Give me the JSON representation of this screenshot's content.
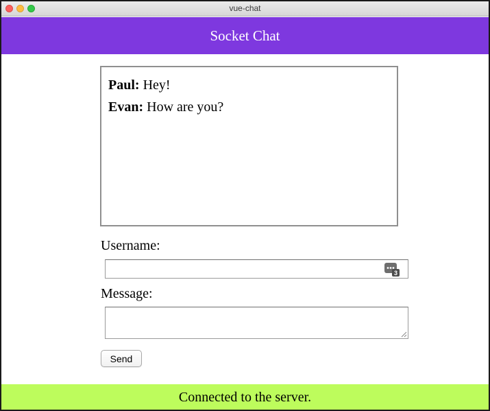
{
  "window": {
    "title": "vue-chat"
  },
  "header": {
    "title": "Socket Chat",
    "background": "#7e38df"
  },
  "messages": [
    {
      "user": "Paul:",
      "text": "Hey!"
    },
    {
      "user": "Evan:",
      "text": "How are you?"
    }
  ],
  "form": {
    "username_label": "Username:",
    "username_value": "",
    "message_label": "Message:",
    "message_value": "",
    "send_label": "Send"
  },
  "status": {
    "text": "Connected to the server.",
    "background": "#bdfc5c"
  },
  "icons": {
    "password_manager": "password-manager-icon",
    "password_manager_count": "3"
  }
}
